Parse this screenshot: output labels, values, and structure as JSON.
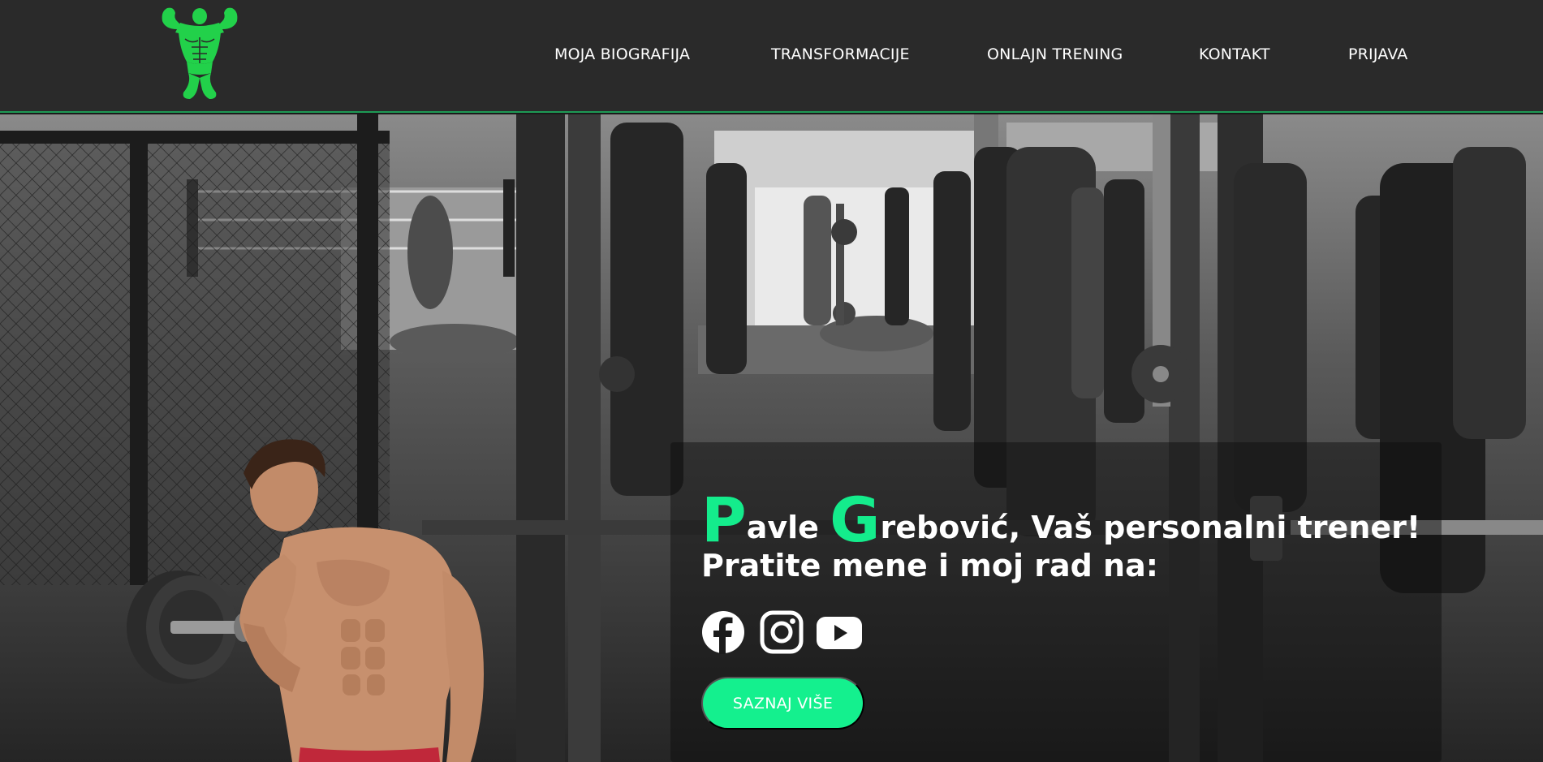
{
  "navbar": {
    "logo_icon": "bodybuilder-logo-icon",
    "items": [
      {
        "label": "MOJA BIOGRAFIJA"
      },
      {
        "label": "TRANSFORMACIJE"
      },
      {
        "label": "ONLAJN TRENING"
      },
      {
        "label": "KONTAKT"
      },
      {
        "label": "PRIJAVA"
      }
    ]
  },
  "hero": {
    "headline": {
      "first_initial": "P",
      "first_rest": "avle ",
      "last_initial": "G",
      "last_rest": "rebović, Vaš personalni trener!"
    },
    "subline": "Pratite mene i moj rad na:",
    "socials": [
      {
        "icon": "facebook-icon"
      },
      {
        "icon": "instagram-icon"
      },
      {
        "icon": "youtube-icon"
      }
    ],
    "cta_label": "SAZNAJ VIŠE"
  },
  "colors": {
    "accent": "#14ec8c",
    "navbar_bg": "#2a2a2a",
    "logo_green": "#22d14a"
  }
}
